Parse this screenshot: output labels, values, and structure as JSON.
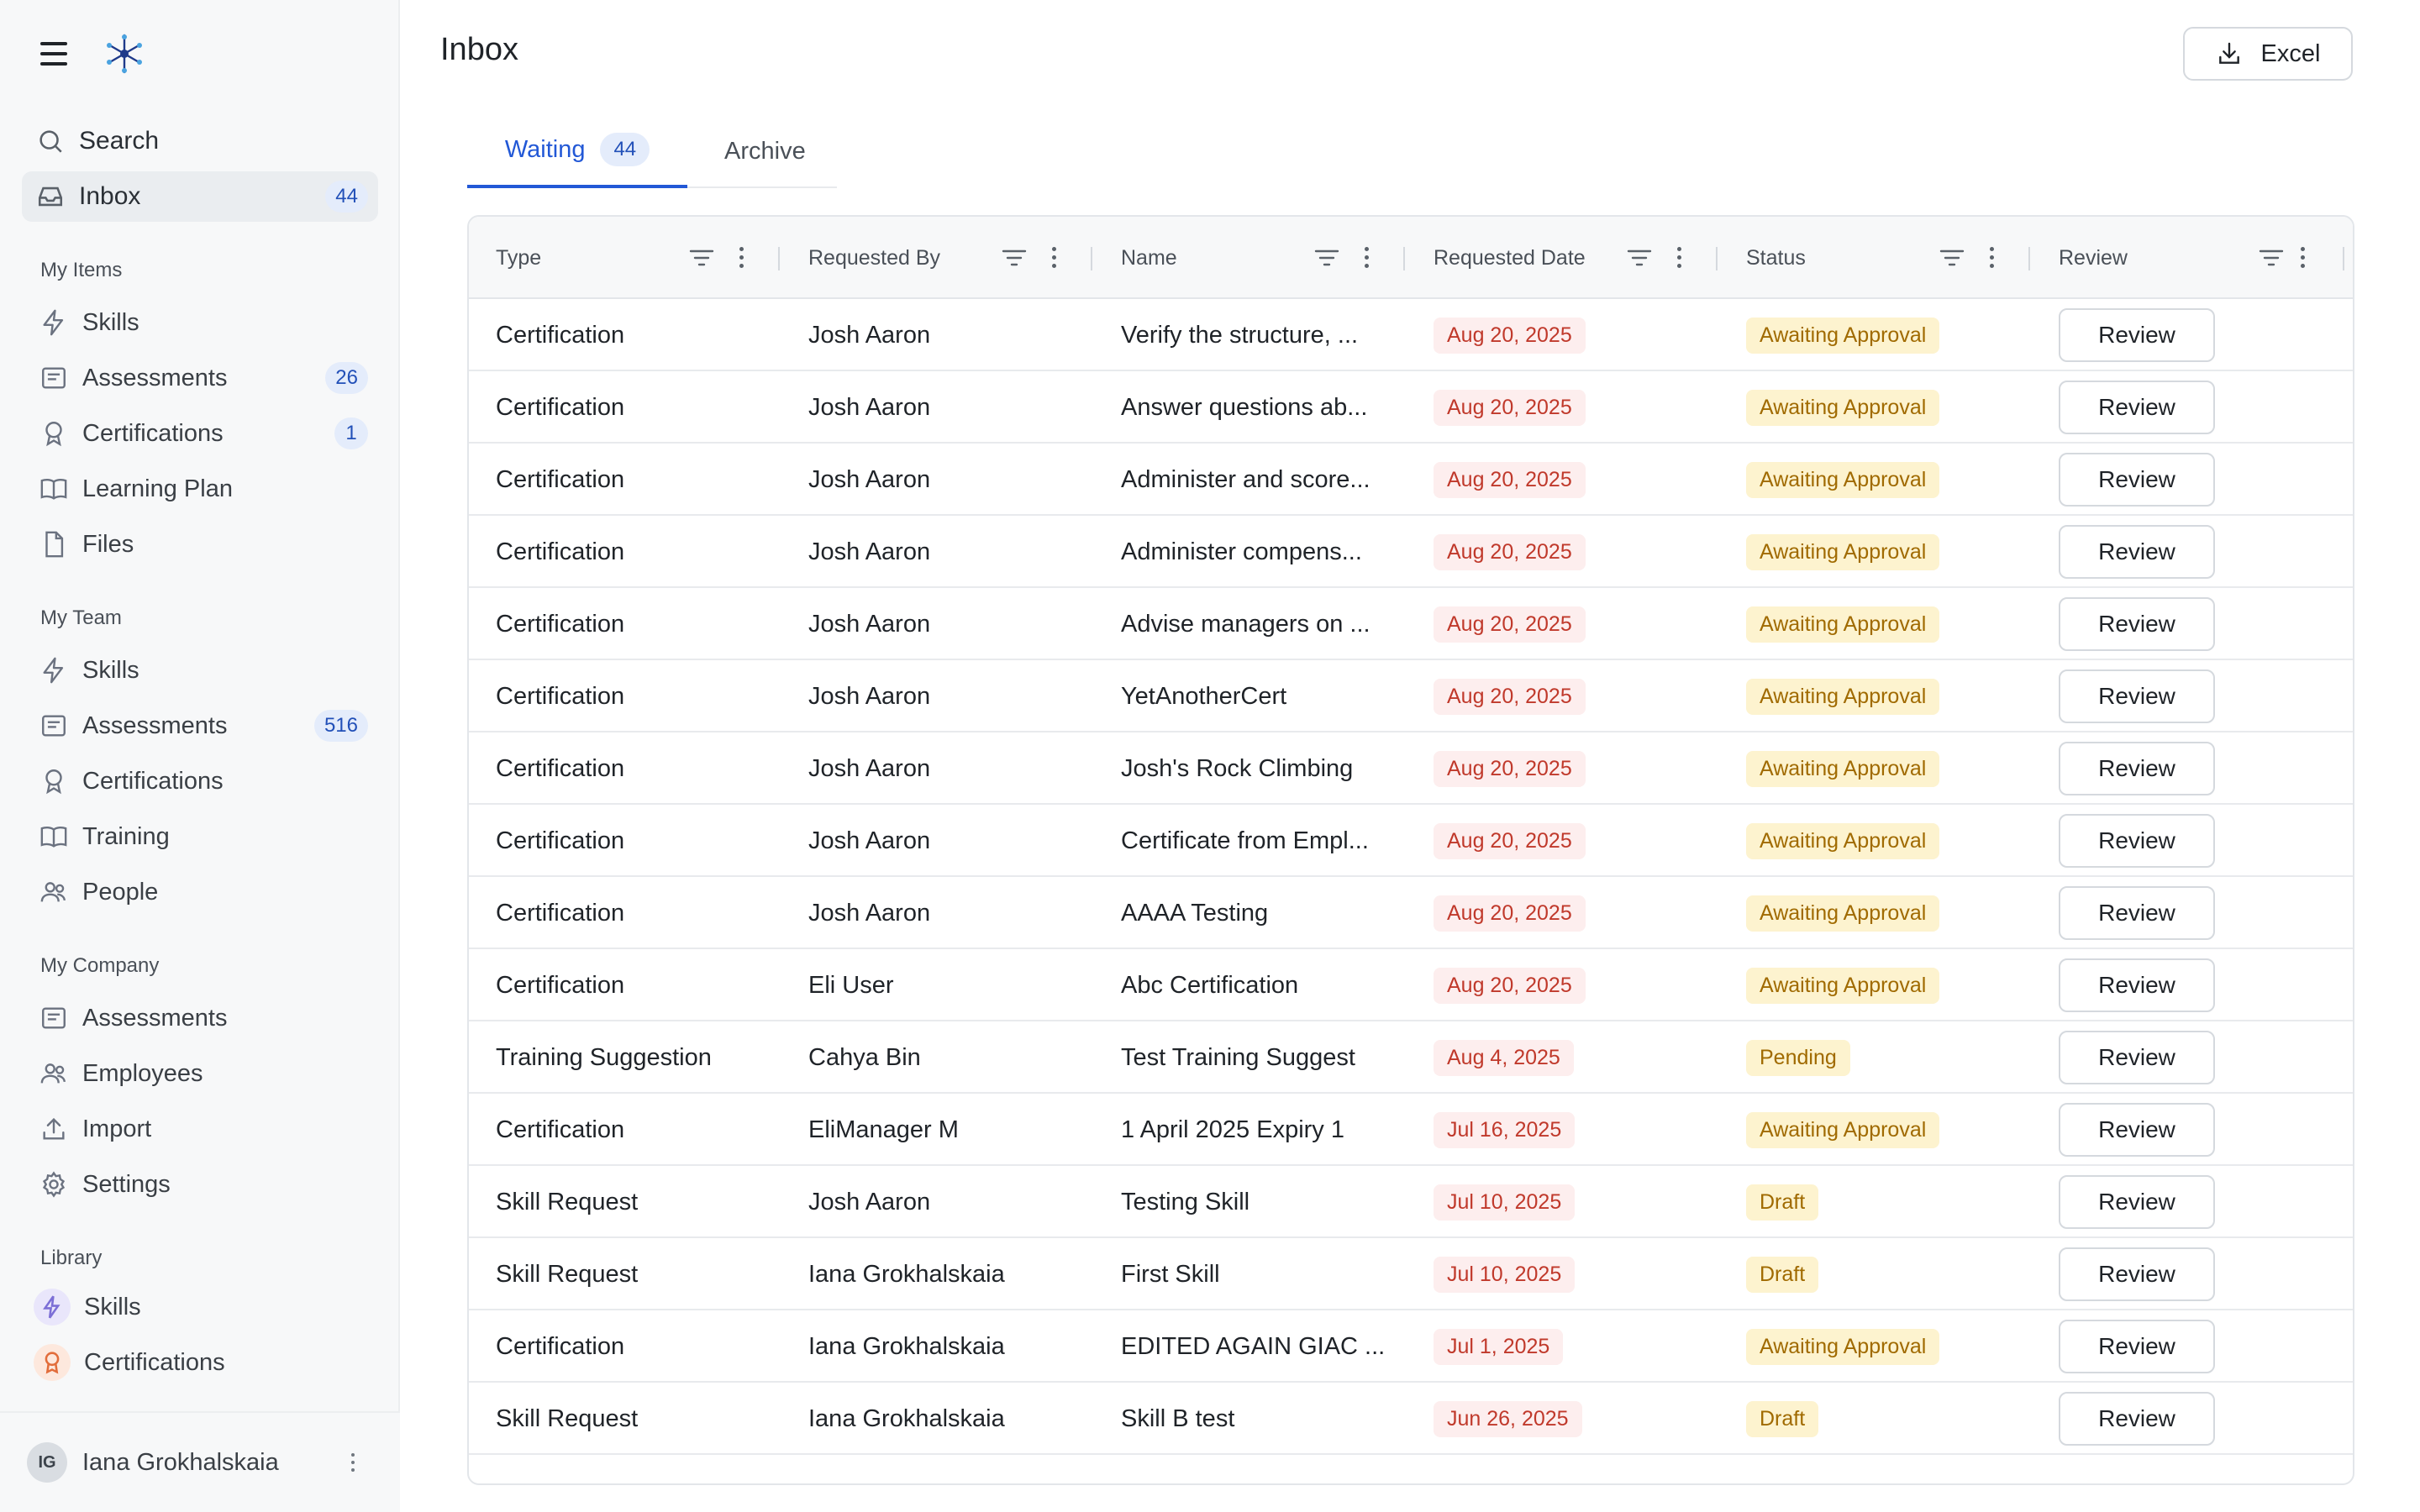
{
  "app": {
    "user_initials": "IG",
    "user_name": "Iana Grokhalskaia"
  },
  "sidebar": {
    "search_label": "Search",
    "inbox_label": "Inbox",
    "inbox_count": "44",
    "sections": [
      {
        "title": "My Items",
        "items": [
          {
            "label": "Skills",
            "icon": "bolt-icon",
            "count": ""
          },
          {
            "label": "Assessments",
            "icon": "form-icon",
            "count": "26"
          },
          {
            "label": "Certifications",
            "icon": "award-icon",
            "count": "1"
          },
          {
            "label": "Learning Plan",
            "icon": "book-icon",
            "count": ""
          },
          {
            "label": "Files",
            "icon": "file-icon",
            "count": ""
          }
        ]
      },
      {
        "title": "My Team",
        "items": [
          {
            "label": "Skills",
            "icon": "bolt-icon",
            "count": ""
          },
          {
            "label": "Assessments",
            "icon": "form-icon",
            "count": "516"
          },
          {
            "label": "Certifications",
            "icon": "award-icon",
            "count": ""
          },
          {
            "label": "Training",
            "icon": "book-icon",
            "count": ""
          },
          {
            "label": "People",
            "icon": "people-icon",
            "count": ""
          }
        ]
      },
      {
        "title": "My Company",
        "items": [
          {
            "label": "Assessments",
            "icon": "form-icon",
            "count": ""
          },
          {
            "label": "Employees",
            "icon": "people-icon",
            "count": ""
          },
          {
            "label": "Import",
            "icon": "upload-icon",
            "count": ""
          },
          {
            "label": "Settings",
            "icon": "gear-icon",
            "count": ""
          }
        ]
      },
      {
        "title": "Library",
        "items": [
          {
            "label": "Skills",
            "icon": "bolt-badge-icon",
            "count": ""
          },
          {
            "label": "Certifications",
            "icon": "award-badge-icon",
            "count": ""
          }
        ]
      }
    ]
  },
  "main": {
    "title": "Inbox",
    "excel_label": "Excel",
    "tabs": [
      {
        "label": "Waiting",
        "count": "44"
      },
      {
        "label": "Archive"
      }
    ],
    "columns": [
      "Type",
      "Requested By",
      "Name",
      "Requested Date",
      "Status",
      "Review"
    ],
    "rows": [
      {
        "type": "Certification",
        "by": "Josh Aaron",
        "name": "Verify the structure, ...",
        "date": "Aug 20, 2025",
        "status": "Awaiting Approval",
        "review": "Review"
      },
      {
        "type": "Certification",
        "by": "Josh Aaron",
        "name": "Answer questions ab...",
        "date": "Aug 20, 2025",
        "status": "Awaiting Approval",
        "review": "Review"
      },
      {
        "type": "Certification",
        "by": "Josh Aaron",
        "name": "Administer and score...",
        "date": "Aug 20, 2025",
        "status": "Awaiting Approval",
        "review": "Review"
      },
      {
        "type": "Certification",
        "by": "Josh Aaron",
        "name": "Administer compens...",
        "date": "Aug 20, 2025",
        "status": "Awaiting Approval",
        "review": "Review"
      },
      {
        "type": "Certification",
        "by": "Josh Aaron",
        "name": "Advise managers on ...",
        "date": "Aug 20, 2025",
        "status": "Awaiting Approval",
        "review": "Review"
      },
      {
        "type": "Certification",
        "by": "Josh Aaron",
        "name": "YetAnotherCert",
        "date": "Aug 20, 2025",
        "status": "Awaiting Approval",
        "review": "Review"
      },
      {
        "type": "Certification",
        "by": "Josh Aaron",
        "name": "Josh's Rock Climbing",
        "date": "Aug 20, 2025",
        "status": "Awaiting Approval",
        "review": "Review"
      },
      {
        "type": "Certification",
        "by": "Josh Aaron",
        "name": "Certificate from Empl...",
        "date": "Aug 20, 2025",
        "status": "Awaiting Approval",
        "review": "Review"
      },
      {
        "type": "Certification",
        "by": "Josh Aaron",
        "name": "AAAA Testing",
        "date": "Aug 20, 2025",
        "status": "Awaiting Approval",
        "review": "Review"
      },
      {
        "type": "Certification",
        "by": "Eli User",
        "name": "Abc Certification",
        "date": "Aug 20, 2025",
        "status": "Awaiting Approval",
        "review": "Review"
      },
      {
        "type": "Training Suggestion",
        "by": "Cahya Bin",
        "name": "Test Training Suggest",
        "date": "Aug 4, 2025",
        "status": "Pending",
        "review": "Review"
      },
      {
        "type": "Certification",
        "by": "EliManager M",
        "name": "1 April 2025 Expiry 1",
        "date": "Jul 16, 2025",
        "status": "Awaiting Approval",
        "review": "Review"
      },
      {
        "type": "Skill Request",
        "by": "Josh Aaron",
        "name": "Testing Skill",
        "date": "Jul 10, 2025",
        "status": "Draft",
        "review": "Review"
      },
      {
        "type": "Skill Request",
        "by": "Iana Grokhalskaia",
        "name": "First Skill",
        "date": "Jul 10, 2025",
        "status": "Draft",
        "review": "Review"
      },
      {
        "type": "Certification",
        "by": "Iana Grokhalskaia",
        "name": "EDITED AGAIN GIAC ...",
        "date": "Jul 1, 2025",
        "status": "Awaiting Approval",
        "review": "Review"
      },
      {
        "type": "Skill Request",
        "by": "Iana Grokhalskaia",
        "name": "Skill B test",
        "date": "Jun 26, 2025",
        "status": "Draft",
        "review": "Review"
      }
    ]
  },
  "colors": {
    "accent": "#2258d6",
    "date_badge_bg": "#fdeeee",
    "date_badge_fg": "#c0392b",
    "status_bg": "#fdf3cf",
    "status_fg": "#a06a00",
    "library_skill": "#e9e6fb",
    "library_cert": "#fde8dd"
  }
}
